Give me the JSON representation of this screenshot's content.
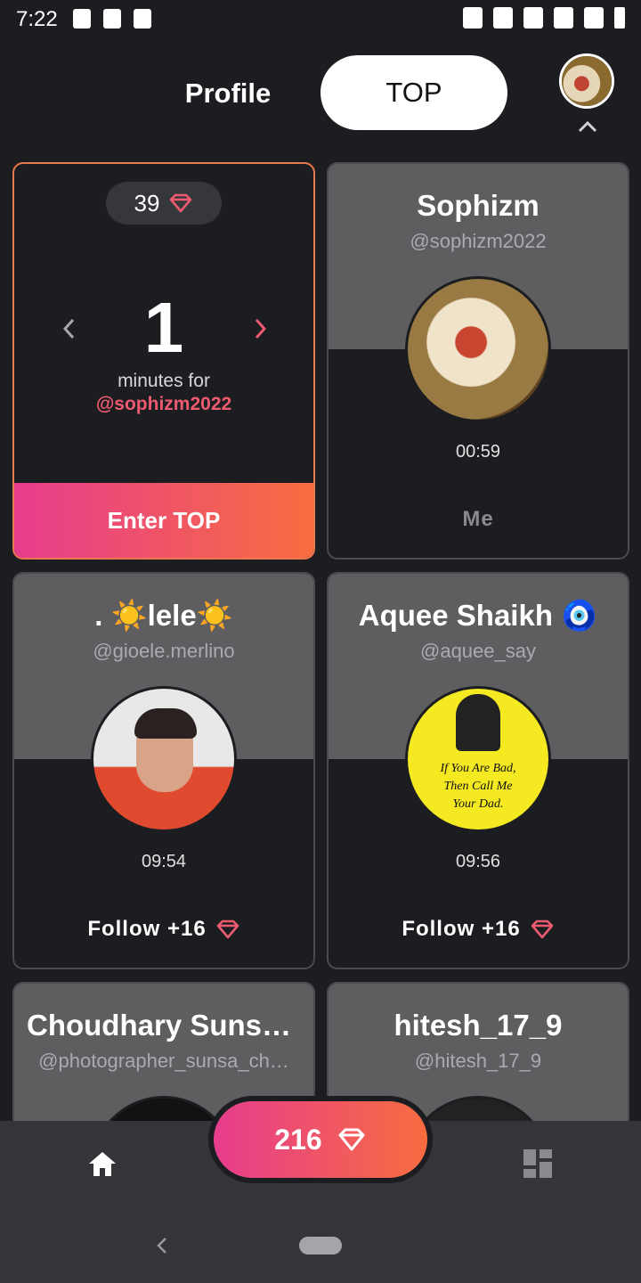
{
  "status_bar": {
    "time": "7:22"
  },
  "header": {
    "profile_tab": "Profile",
    "top_tab": "TOP"
  },
  "top_card": {
    "gems": "39",
    "minutes": "1",
    "minutes_label": "minutes for",
    "user": "@sophizm2022",
    "button": "Enter TOP"
  },
  "cards": [
    {
      "name": "Sophizm",
      "handle": "@sophizm2022",
      "time": "00:59",
      "action": "Me"
    },
    {
      "name": ".   ☀️lele☀️",
      "handle": "@gioele.merlino",
      "time": "09:54",
      "action": "Follow +16"
    },
    {
      "name": "Aquee Shaikh 🧿",
      "handle": "@aquee_say",
      "time": "09:56",
      "action": "Follow +16"
    },
    {
      "name": "Choudhary Sunsa…",
      "handle": "@photographer_sunsa_ch…"
    },
    {
      "name": "hitesh_17_9",
      "handle": "@hitesh_17_9"
    }
  ],
  "avatar_text": {
    "line1": "If You Are Bad,",
    "line2": "Then Call Me",
    "line3": "Your Dad."
  },
  "bottom": {
    "gems": "216"
  },
  "colors": {
    "accent_start": "#e63d8e",
    "accent_end": "#f86c3f",
    "gem": "#ee5a6f"
  }
}
